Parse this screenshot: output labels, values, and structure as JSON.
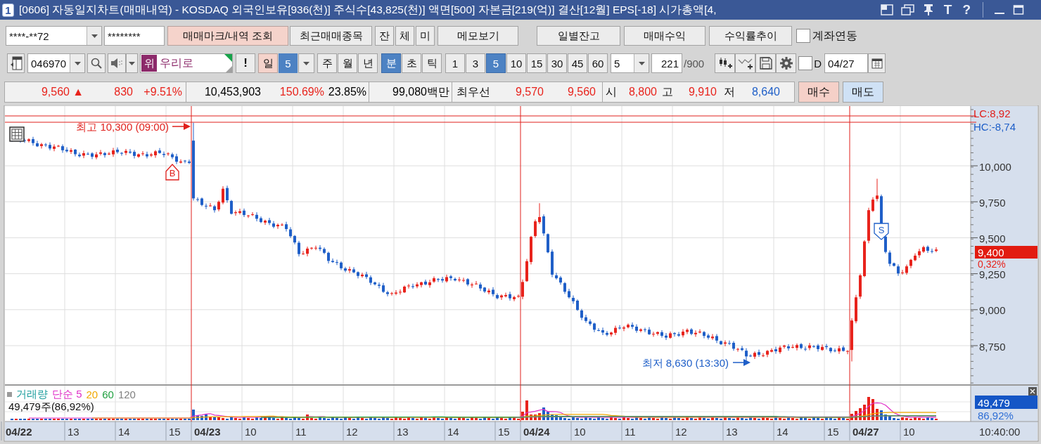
{
  "window": {
    "badge": "1",
    "title": "[0606] 자동일지차트(매매내역) - KOSDAQ 외국인보유[936(천)] 주식수[43,825(천)] 액면[500] 자본금[219(억)] 결산[12월] EPS[-18] 시가총액[4,",
    "text_buttons": [
      "T",
      "?"
    ]
  },
  "account_bar": {
    "account": "****-**72",
    "password": "********",
    "buttons": [
      {
        "label": "매매마크/내역 조회",
        "kind": "accent"
      },
      {
        "label": "최근매매종목",
        "kind": "plain"
      },
      {
        "label": "잔",
        "kind": "plain"
      },
      {
        "label": "체",
        "kind": "plain"
      },
      {
        "label": "미",
        "kind": "plain"
      },
      {
        "label": "메모보기",
        "kind": "plain"
      }
    ],
    "report_buttons": [
      "일별잔고",
      "매매수익",
      "수익률추이"
    ],
    "link_checkbox": {
      "label": "계좌연동",
      "checked": false
    }
  },
  "chart_toolbar": {
    "code": "046970",
    "market_badge": "위",
    "stock_name": "우리로",
    "alert_button": "!",
    "day_button": "일",
    "day_count": "5",
    "periods": [
      {
        "label": "주",
        "selected": false
      },
      {
        "label": "월",
        "selected": false
      },
      {
        "label": "년",
        "selected": false
      }
    ],
    "units": [
      {
        "label": "분",
        "selected": true
      },
      {
        "label": "초",
        "selected": false
      },
      {
        "label": "틱",
        "selected": false
      }
    ],
    "intervals": [
      {
        "label": "1",
        "selected": false
      },
      {
        "label": "3",
        "selected": false
      },
      {
        "label": "5",
        "selected": true
      },
      {
        "label": "10",
        "selected": false
      },
      {
        "label": "15",
        "selected": false
      },
      {
        "label": "30",
        "selected": false
      },
      {
        "label": "45",
        "selected": false
      },
      {
        "label": "60",
        "selected": false
      }
    ],
    "interval_value": "5",
    "count": "221",
    "count_max": "/900",
    "date_checkbox": {
      "label": "D",
      "checked": false
    },
    "date": "04/27"
  },
  "quote_bar": {
    "groups": [
      [
        {
          "text": "9,560",
          "kind": "value",
          "color": "#e8231c"
        },
        {
          "text": "▲",
          "kind": "value",
          "color": "#e8231c"
        },
        {
          "text": "830",
          "kind": "value",
          "color": "#e8231c"
        },
        {
          "text": "+9.51%",
          "kind": "value",
          "color": "#e8231c"
        }
      ],
      [
        {
          "text": "10,453,903",
          "kind": "value",
          "color": "#000000"
        },
        {
          "text": "150.69%",
          "kind": "value",
          "color": "#e8231c"
        },
        {
          "text": "23.85%",
          "kind": "value",
          "color": "#000000"
        }
      ],
      [
        {
          "text": "99,080백만",
          "kind": "value",
          "color": "#000000"
        }
      ],
      [
        {
          "text": "최우선",
          "kind": "label"
        },
        {
          "text": "9,570",
          "kind": "value",
          "color": "#e8231c"
        },
        {
          "text": "9,560",
          "kind": "value",
          "color": "#e8231c"
        }
      ],
      [
        {
          "text": "시",
          "kind": "label"
        },
        {
          "text": "8,800",
          "kind": "value",
          "color": "#e8231c"
        },
        {
          "text": "고",
          "kind": "label"
        },
        {
          "text": "9,910",
          "kind": "value",
          "color": "#e8231c"
        },
        {
          "text": "저",
          "kind": "label"
        },
        {
          "text": "8,640",
          "kind": "value",
          "color": "#1f5fc8"
        }
      ]
    ],
    "order_buttons": [
      {
        "label": "매수",
        "kind": "buy"
      },
      {
        "label": "매도",
        "kind": "sell"
      }
    ]
  },
  "price_panel": {
    "y_labels": [
      "10,000",
      "9,750",
      "9,500",
      "9,250",
      "9,000",
      "8,750"
    ],
    "lc_label": "LC:8,92",
    "hc_label": "HC:-8,74",
    "high_note": "최고 10,300 (09:00)",
    "low_note": "최저 8,630 (13:30)",
    "buy_mark": "B",
    "sell_mark": "S",
    "last_price": "9,400",
    "last_change": "0,32%"
  },
  "volume_panel": {
    "legend": [
      {
        "text": "거래량",
        "color": "#1e9e9e"
      },
      {
        "text": "단순 5",
        "color": "#e030c8"
      },
      {
        "text": "20",
        "color": "#f0a800"
      },
      {
        "text": "60",
        "color": "#20a040"
      },
      {
        "text": "120",
        "color": "#808080"
      }
    ],
    "summary": "49,479주(86,92%)",
    "last_volume": "49,479",
    "last_ratio": "86,92%"
  },
  "time_axis": {
    "labels": [
      {
        "text": "04/22",
        "kind": "date"
      },
      {
        "text": "13",
        "kind": "hour"
      },
      {
        "text": "14",
        "kind": "hour"
      },
      {
        "text": "15",
        "kind": "hour"
      },
      {
        "text": "04/23",
        "kind": "date"
      },
      {
        "text": "10",
        "kind": "hour"
      },
      {
        "text": "11",
        "kind": "hour"
      },
      {
        "text": "12",
        "kind": "hour"
      },
      {
        "text": "13",
        "kind": "hour"
      },
      {
        "text": "14",
        "kind": "hour"
      },
      {
        "text": "15",
        "kind": "hour"
      },
      {
        "text": "04/24",
        "kind": "date"
      },
      {
        "text": "10",
        "kind": "hour"
      },
      {
        "text": "11",
        "kind": "hour"
      },
      {
        "text": "12",
        "kind": "hour"
      },
      {
        "text": "13",
        "kind": "hour"
      },
      {
        "text": "14",
        "kind": "hour"
      },
      {
        "text": "15",
        "kind": "hour"
      },
      {
        "text": "04/27",
        "kind": "date"
      },
      {
        "text": "10",
        "kind": "hour"
      }
    ],
    "current_time": "10:40:00"
  }
}
